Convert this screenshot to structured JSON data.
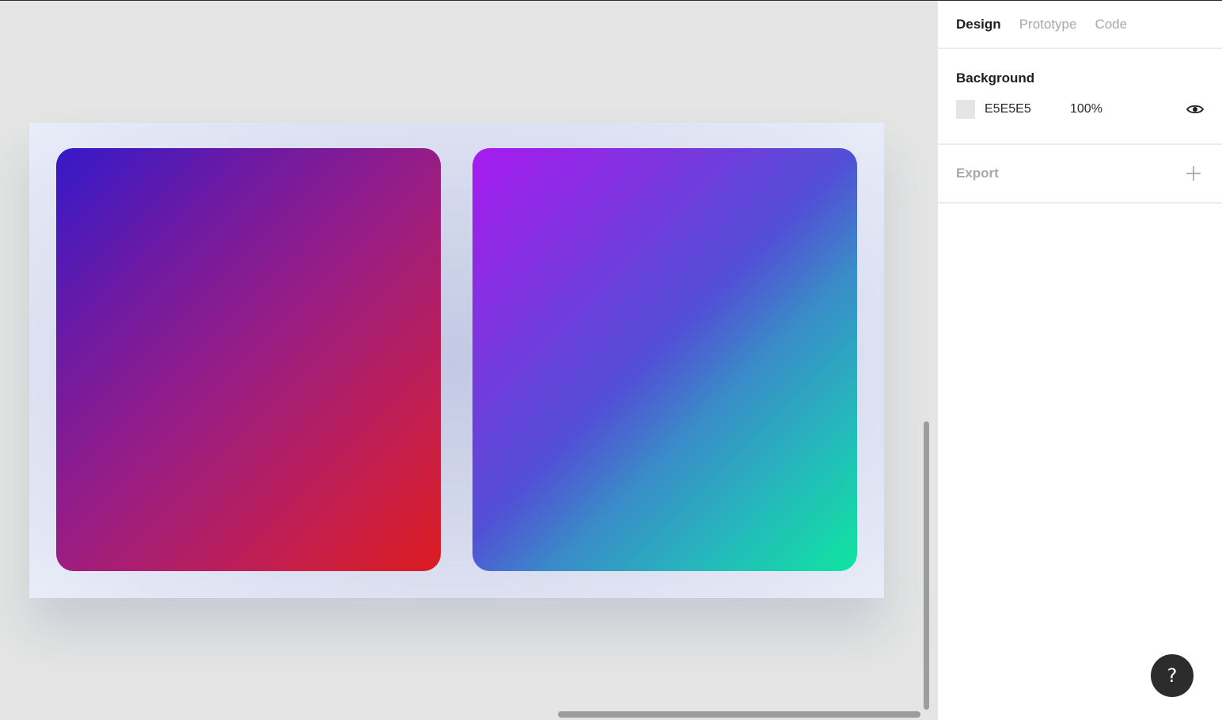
{
  "tabs": [
    {
      "label": "Design",
      "active": true
    },
    {
      "label": "Prototype",
      "active": false
    },
    {
      "label": "Code",
      "active": false
    }
  ],
  "background": {
    "title": "Background",
    "color_hex": "E5E5E5",
    "opacity": "100%",
    "swatch_color": "#E5E5E5"
  },
  "export": {
    "title": "Export"
  },
  "canvas": {
    "card_1_gradient": [
      "#3519CA",
      "#9A1D84",
      "#DE1C20"
    ],
    "card_2_gradient": [
      "#A81AF0",
      "#524FD6",
      "#0FE5A0"
    ]
  },
  "help": {
    "label": "?"
  }
}
